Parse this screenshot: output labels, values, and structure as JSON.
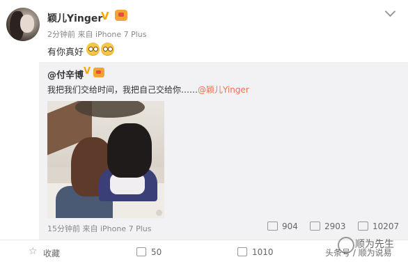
{
  "post": {
    "username": "颖儿Yinger",
    "meta": "2分钟前 来自 iPhone 7 Plus",
    "text": "有你真好",
    "emoji_count": 2
  },
  "repost": {
    "username": "@付辛博",
    "text": "我把我们交给时间，我把自己交给你……",
    "mention": "@颖儿Yinger",
    "meta": "15分钟前 来自 iPhone 7 Plus",
    "forwards": "904",
    "comments": "2903",
    "likes": "10207"
  },
  "actions": {
    "favorite_label": "收藏",
    "forward_count": "50",
    "comment_count": "1010"
  },
  "watermark": {
    "name": "顺为先生",
    "sub": "头条号 / 顺为说易"
  },
  "colors": {
    "mention": "#eb7350",
    "verified": "#f5a800",
    "repost_bg": "#f2f2f5"
  }
}
